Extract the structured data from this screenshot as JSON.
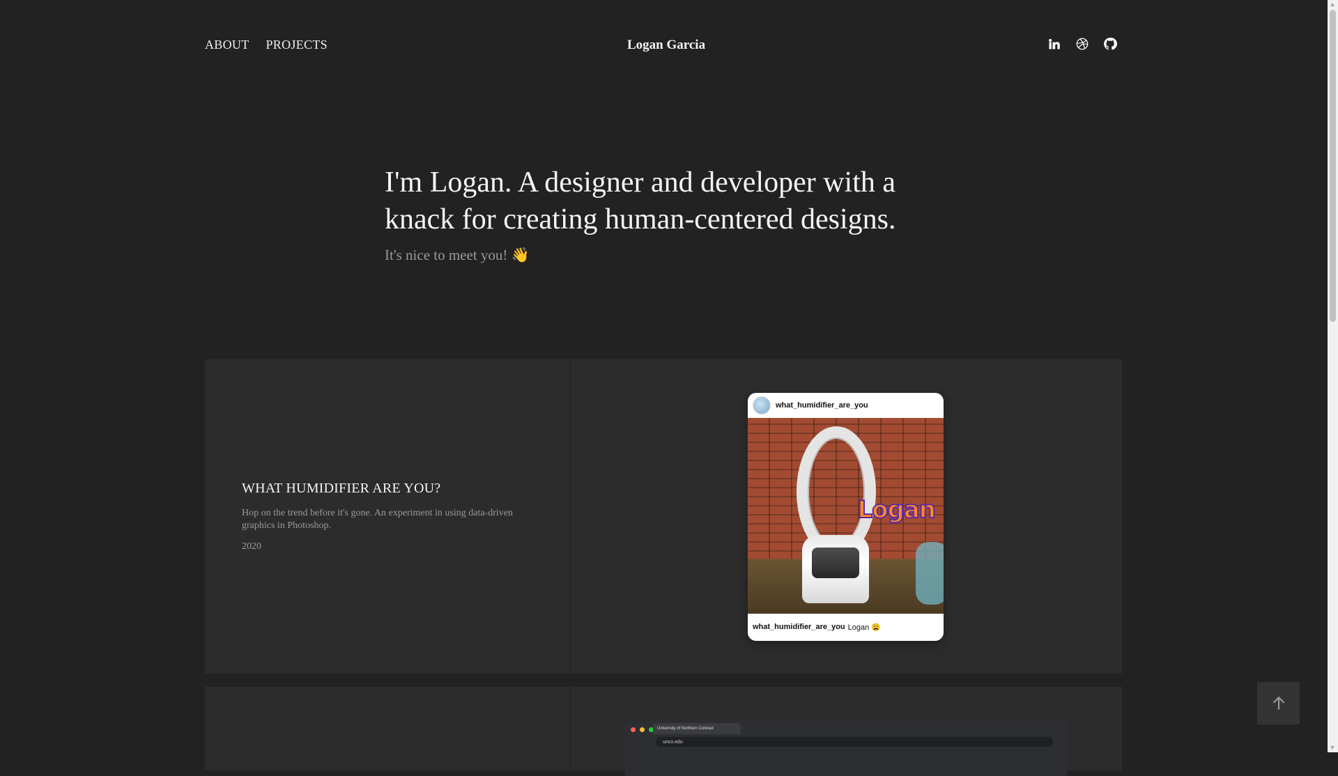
{
  "nav": {
    "about": "ABOUT",
    "projects": "PROJECTS",
    "brand": "Logan Garcia"
  },
  "socials": [
    {
      "name": "linkedin-icon"
    },
    {
      "name": "dribbble-icon"
    },
    {
      "name": "github-icon"
    }
  ],
  "hero": {
    "headline": "I'm Logan. A designer and developer with a knack for creating human-centered designs.",
    "subline": "It's nice to meet you! 👋"
  },
  "projects": [
    {
      "title": "WHAT HUMIDIFIER ARE YOU?",
      "description": "Hop on the trend before it's gone. An experiment in using data-driven graphics in Photoshop.",
      "year": "2020",
      "preview": {
        "username": "what_humidifier_are_you",
        "overlay_text": "Logan",
        "caption_user": "what_humidifier_are_you",
        "caption_text": "Logan 😩"
      }
    },
    {
      "preview": {
        "tab_title": "University of Northern Colorad",
        "url": "unco.edu"
      }
    }
  ],
  "colors": {
    "background": "#222222",
    "card": "#2c2c2c",
    "text": "#f2f2f2",
    "muted": "#9a9a9a"
  },
  "back_to_top_icon": "arrow-up-icon"
}
